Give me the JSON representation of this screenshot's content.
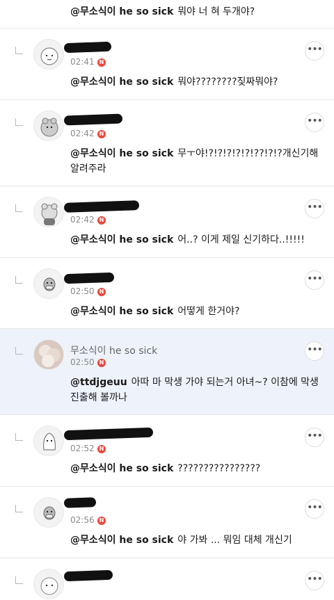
{
  "top": {
    "mention": "@무소식이 he so sick",
    "text": "뭐야 너 혀 두개야?"
  },
  "replies": [
    {
      "time": "02:41",
      "badge": "N",
      "mention": "@무소식이 he so sick",
      "text": "뭐야????????짖짜뭐야?",
      "more": "•••"
    },
    {
      "time": "02:42",
      "badge": "N",
      "mention": "@무소식이 he so sick",
      "text": "무ㅜ야!?!?!?!?!?!??!?!?개신기해 알려주라",
      "more": "•••"
    },
    {
      "time": "02:42",
      "badge": "N",
      "mention": "@무소식이 he so sick",
      "text": "어..? 이게 제일 신기하다..!!!!!",
      "more": "•••"
    },
    {
      "time": "02:50",
      "badge": "N",
      "mention": "@무소식이 he so sick",
      "text": "어떻게 한거야?",
      "more": "•••"
    },
    {
      "name": "무소식이 he so sick",
      "time": "02:50",
      "badge": "N",
      "mention": "@ttdjgeuu",
      "text": "아따 마 막생 가야 되는거 아녀~? 이참에 막생 진출해 볼까나",
      "more": "•••"
    },
    {
      "time": "02:52",
      "badge": "N",
      "mention": "@무소식이 he so sick",
      "text": "????????????????",
      "more": "•••"
    },
    {
      "time": "02:56",
      "badge": "N",
      "mention": "@무소식이 he so sick",
      "text": "야 가봐 ... 뭐임 대체 개신기",
      "more": "•••"
    },
    {
      "more": "•••"
    }
  ]
}
